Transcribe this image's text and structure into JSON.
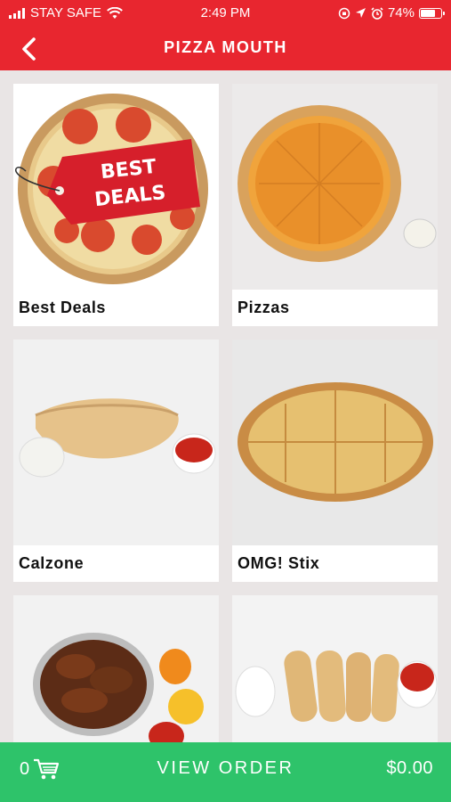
{
  "status_bar": {
    "carrier": "STAY SAFE",
    "time": "2:49 PM",
    "battery": "74%",
    "battery_level": 0.74
  },
  "header": {
    "title": "PIZZA MOUTH",
    "back_icon": "chevron-left-icon"
  },
  "categories": [
    {
      "label": "Best Deals",
      "badge_line1": "BEST",
      "badge_line2": "DEALS"
    },
    {
      "label": "Pizzas"
    },
    {
      "label": "Calzone"
    },
    {
      "label": "OMG! Stix"
    },
    {
      "label": ""
    },
    {
      "label": ""
    }
  ],
  "footer": {
    "cart_count": "0",
    "cart_icon": "cart-icon",
    "view_order_label": "VIEW ORDER",
    "total": "$0.00"
  },
  "colors": {
    "header": "#e8262f",
    "footer": "#2ec36a",
    "background": "#e9e5e5"
  }
}
